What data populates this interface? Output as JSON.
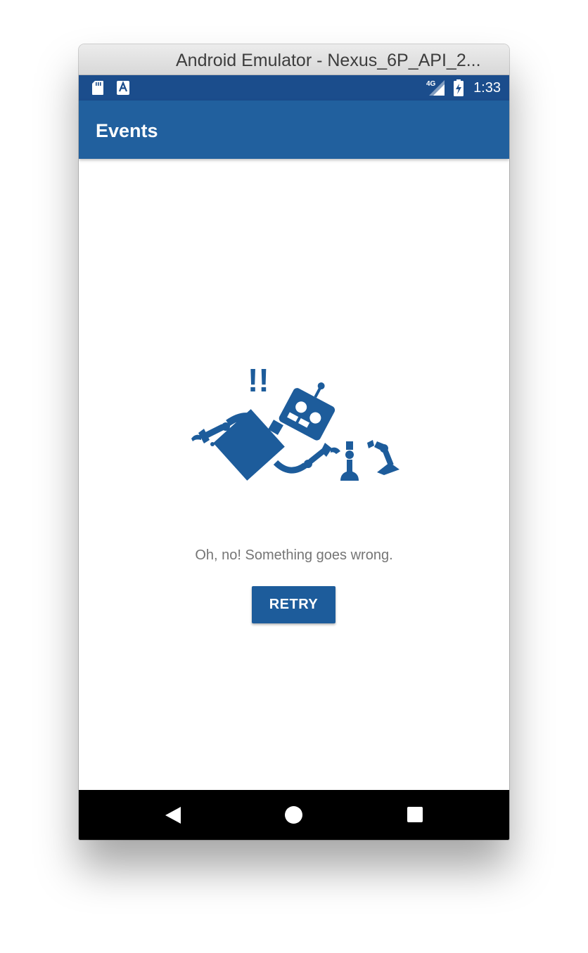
{
  "window": {
    "title": "Android Emulator - Nexus_6P_API_2..."
  },
  "status_bar": {
    "time": "1:33",
    "network_label": "4G",
    "icons": [
      "sd-card-icon",
      "a-notification-icon",
      "signal-4g-icon",
      "battery-charging-icon"
    ]
  },
  "app_bar": {
    "title": "Events"
  },
  "error": {
    "illustration_exclaim": "!!",
    "message": "Oh, no! Something goes wrong.",
    "retry_label": "RETRY"
  },
  "nav_bar": {
    "icons": [
      "back-icon",
      "home-icon",
      "recents-icon"
    ]
  },
  "colors": {
    "primary": "#21609e",
    "status_bar": "#1b4d8c",
    "button": "#1d5c9b",
    "message_text": "#757575"
  }
}
